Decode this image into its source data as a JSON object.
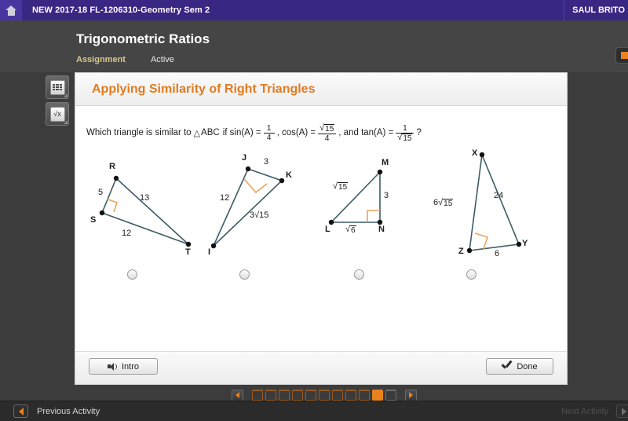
{
  "topbar": {
    "home_icon": "home-icon",
    "course_title": "NEW 2017-18 FL-1206310-Geometry Sem 2",
    "user_name": "SAUL BRITO"
  },
  "lesson": {
    "title": "Trigonometric Ratios",
    "type_label": "Assignment",
    "status_label": "Active"
  },
  "tools": [
    {
      "name": "calculator-tool",
      "icon": "calculator-icon"
    },
    {
      "name": "formula-tool",
      "icon": "square-root-icon",
      "glyph": "√x"
    }
  ],
  "card": {
    "heading": "Applying Similarity of Right Triangles",
    "question": {
      "lead": "Which triangle is similar to",
      "triangle_symbol": "△",
      "abc": "ABC",
      "sin_label": "if sin(A) =",
      "sin_num": "1",
      "sin_den": "4",
      "cos_label": ", cos(A) =",
      "cos_num_radical": "15",
      "cos_den": "4",
      "tan_label": ", and tan(A) =",
      "tan_num": "1",
      "tan_den_radical": "15",
      "tail": "?"
    },
    "answers": [
      {
        "id": "choice-a",
        "triangle": "RST",
        "vertices": [
          "R",
          "S",
          "T"
        ],
        "sides": [
          "5",
          "13",
          "12"
        ],
        "right_angle_at": "S",
        "selected": false
      },
      {
        "id": "choice-b",
        "triangle": "IJK",
        "vertices": [
          "J",
          "K",
          "I"
        ],
        "sides": [
          "3",
          "12",
          "3√15"
        ],
        "right_angle_at": "J",
        "selected": false
      },
      {
        "id": "choice-c",
        "triangle": "LMN",
        "vertices": [
          "M",
          "L",
          "N"
        ],
        "sides": [
          "√15",
          "3",
          "√6"
        ],
        "right_angle_at": "N",
        "selected": false
      },
      {
        "id": "choice-d",
        "triangle": "XYZ",
        "vertices": [
          "X",
          "Y",
          "Z"
        ],
        "sides": [
          "6√15",
          "24",
          "6"
        ],
        "right_angle_at": "Z",
        "selected": false
      }
    ],
    "footer": {
      "intro_label": "Intro",
      "intro_icon": "speaker-icon",
      "done_label": "Done",
      "done_icon": "check-icon"
    }
  },
  "pager": {
    "prev_icon": "caret-left-icon",
    "next_icon": "caret-right-icon",
    "total_pages": 11,
    "current_page": 10,
    "completed_through": 9
  },
  "statusbar": {
    "prev_activity_label": "Previous Activity",
    "prev_activity_icon": "caret-left-icon",
    "next_activity_label": "Next Activity",
    "next_activity_icon": "caret-right-icon"
  },
  "colors": {
    "brand_purple": "#3a2683",
    "accent_orange": "#e8821e",
    "heading_orange": "#e07b22",
    "figure_stroke": "#3c5c66",
    "right_angle": "#e8a35c"
  }
}
